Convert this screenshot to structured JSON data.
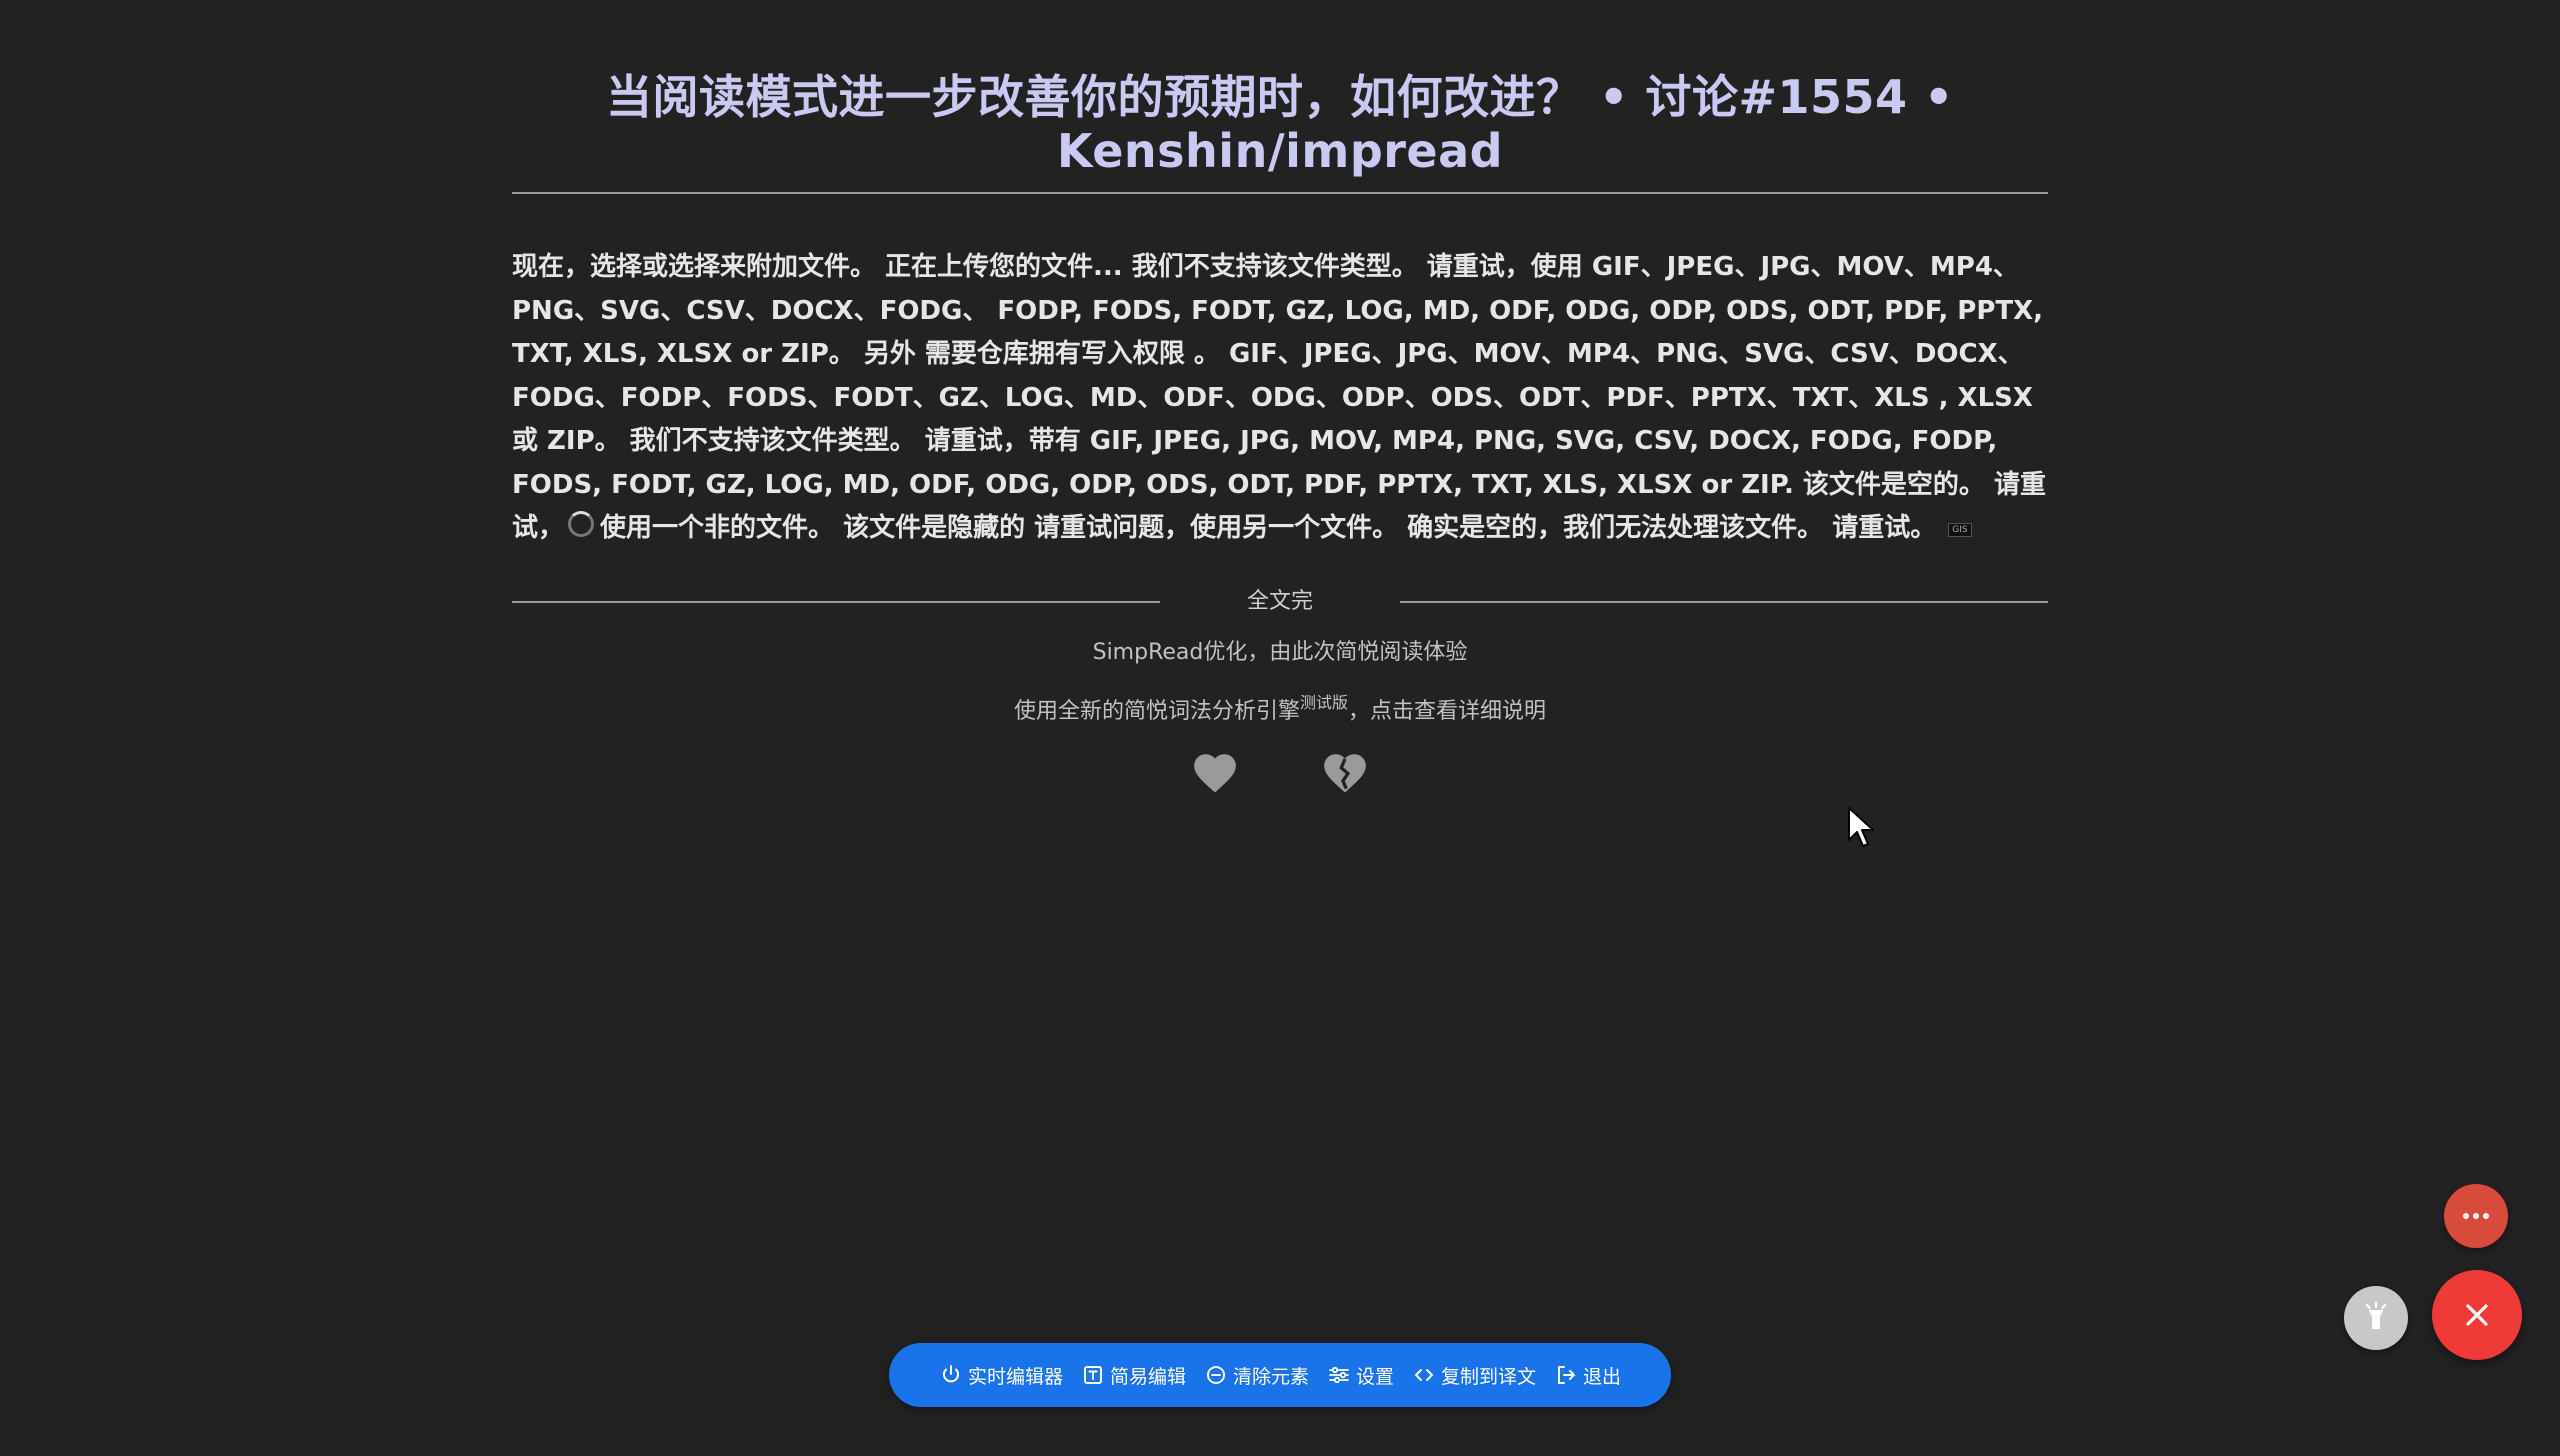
{
  "article": {
    "title": "当阅读模式进一步改善你的预期时，如何改进？ • 讨论#1554 • Kenshin/impread",
    "content_before_spinner": "现在，选择或选择来附加文件。 正在上传您的文件... 我们不支持该文件类型。 请重试，使用 GIF、JPEG、JPG、MOV、MP4、PNG、SVG、CSV、DOCX、FODG、 FODP, FODS, FODT, GZ, LOG, MD, ODF, ODG, ODP, ODS, ODT, PDF, PPTX, TXT, XLS, XLSX or ZIP。 另外 需要仓库拥有写入权限 。 GIF、JPEG、JPG、MOV、MP4、PNG、SVG、CSV、DOCX、FODG、FODP、FODS、FODT、GZ、LOG、MD、ODF、ODG、ODP、ODS、ODT、PDF、PPTX、TXT、XLS , XLSX 或 ZIP。 我们不支持该文件类型。 请重试，带有 GIF, JPEG, JPG, MOV, MP4, PNG, SVG, CSV, DOCX, FODG, FODP, FODS, FODT, GZ, LOG, MD, ODF, ODG, ODP, ODS, ODT, PDF, PPTX, TXT, XLS, XLSX or ZIP. 该文件是空的。 请重试，",
    "content_after_spinner": "使用一个非的文件。 该文件是隐藏的 请重试问题，使用另一个文件。 确实是空的，我们无法处理该文件。 请重试。",
    "tiny_tag": "GIS"
  },
  "footer": {
    "end_label": "全文完",
    "optimized_line": "SimpRead优化，由此次简悦阅读体验",
    "engine_line_prefix": "使用全新的简悦词法分析引擎",
    "engine_line_sup": "测试版",
    "engine_line_suffix": "，点击查看详细说明"
  },
  "icons": {
    "like": "heart-icon",
    "dislike": "broken-heart-icon",
    "heart_color": "#9a9a9a"
  },
  "toolbar": {
    "items": [
      {
        "label": "实时编辑器",
        "icon": "power-icon"
      },
      {
        "label": "简易编辑",
        "icon": "text-box-icon"
      },
      {
        "label": "清除元素",
        "icon": "minus-circle-icon"
      },
      {
        "label": "设置",
        "icon": "sliders-icon"
      },
      {
        "label": "复制到译文",
        "icon": "code-icon"
      },
      {
        "label": "退出",
        "icon": "exit-icon"
      }
    ],
    "color": "#1a73e8"
  },
  "fabs": {
    "more_color": "#d84a3c",
    "light_color": "#c8c8c8",
    "close_color": "#ef3b37"
  }
}
